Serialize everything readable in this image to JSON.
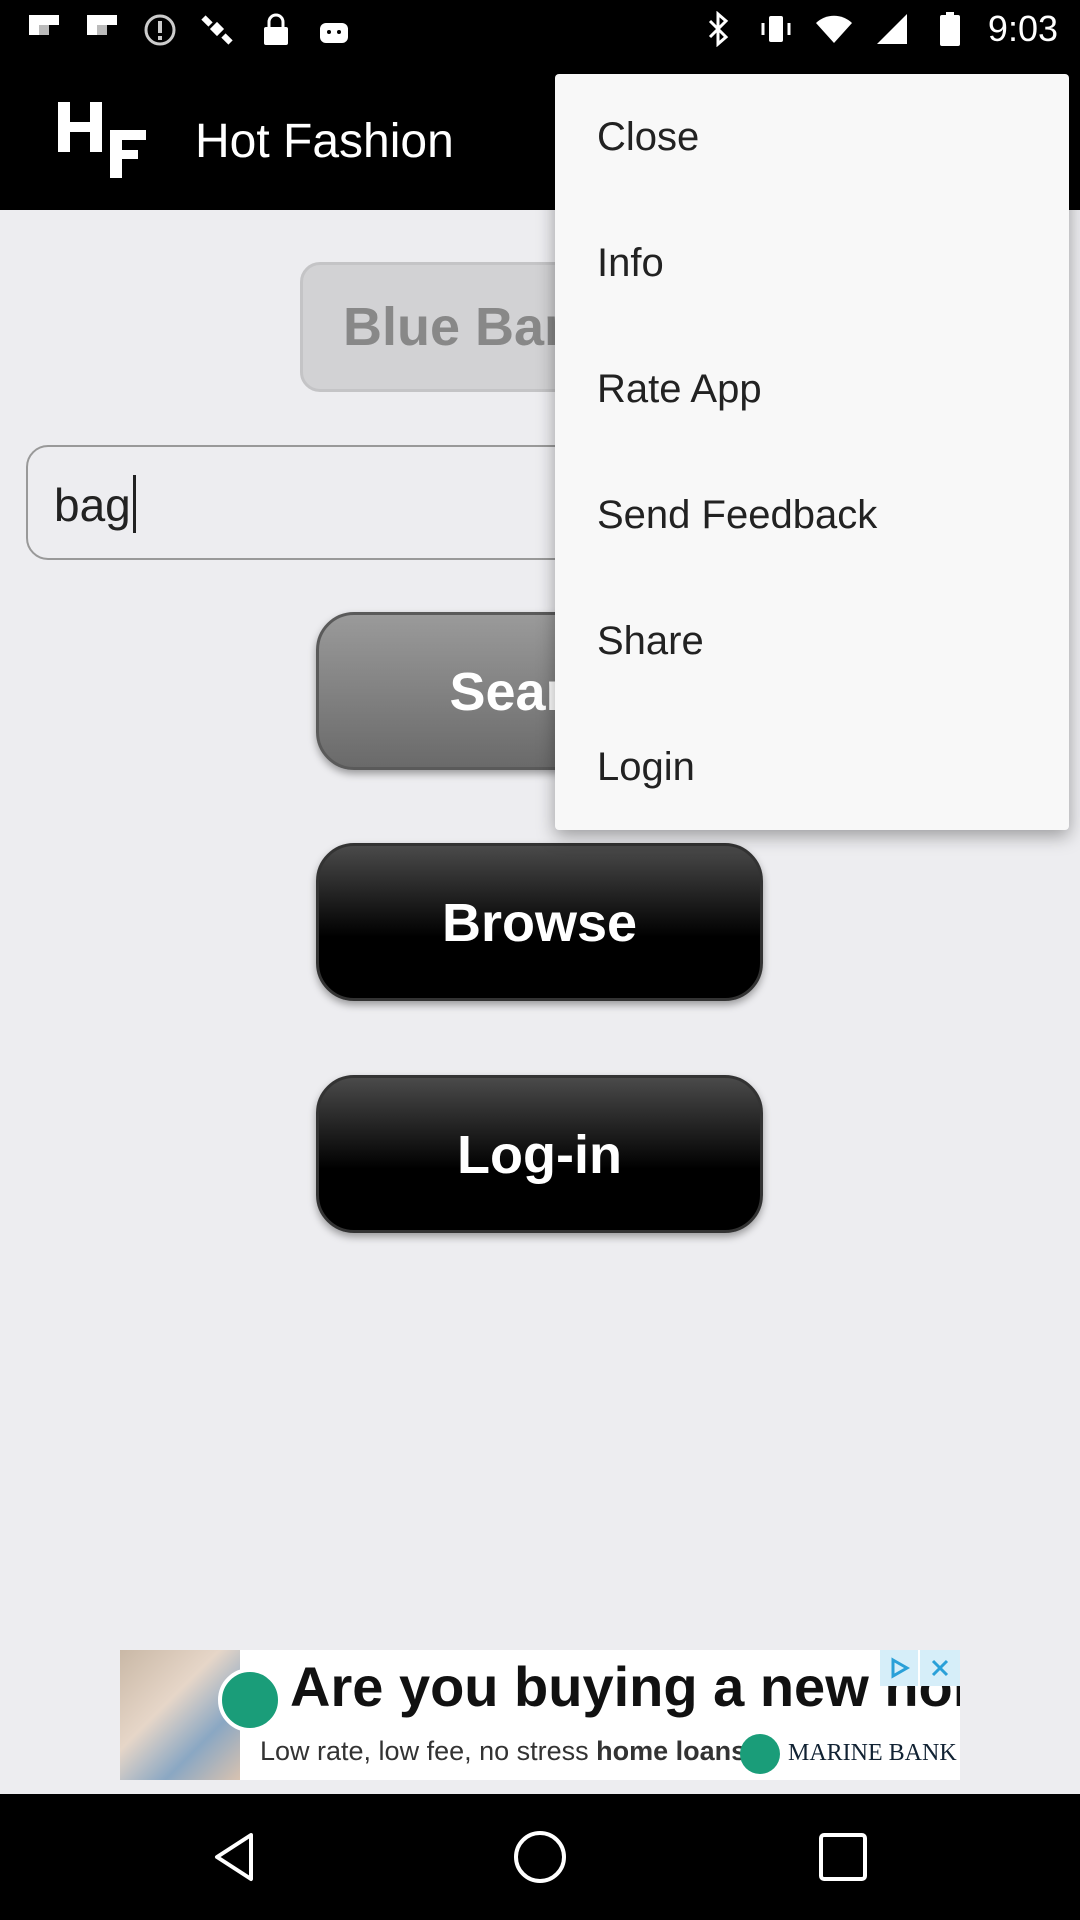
{
  "status_bar": {
    "time": "9:03",
    "left_icons": [
      "flipboard-icon",
      "flipboard-icon",
      "alert-icon",
      "satellite-icon",
      "lock-icon",
      "android-icon"
    ],
    "right_icons": [
      "bluetooth-icon",
      "vibrate-icon",
      "wifi-icon",
      "signal-icon",
      "battery-icon"
    ]
  },
  "app_bar": {
    "title": "Hot Fashion",
    "logo_text_h": "H",
    "logo_text_f": "F"
  },
  "main": {
    "brand_chip": "Blue Banana",
    "search_value": "bag",
    "search_button": "Search",
    "browse_button": "Browse",
    "login_button": "Log-in"
  },
  "menu": {
    "items": [
      "Close",
      "Info",
      "Rate App",
      "Send Feedback",
      "Share",
      "Login"
    ]
  },
  "ad": {
    "headline": "Are you buying a new home?",
    "sub_prefix": "Low rate, low fee, no stress ",
    "sub_bold": "home loans",
    "bank": "MARINE BANK"
  },
  "colors": {
    "bar_black": "#000000",
    "background": "#ededf0",
    "menu_bg": "#f8f8f8",
    "ad_green": "#1a9d79"
  }
}
